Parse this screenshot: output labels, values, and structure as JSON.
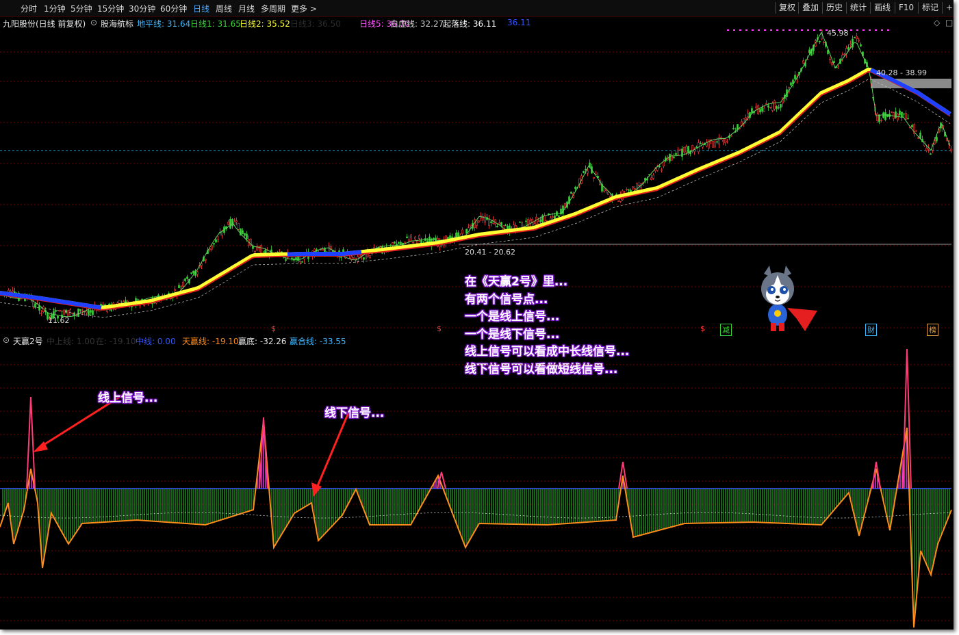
{
  "toolbar": {
    "periods": [
      "分时",
      "1分钟",
      "5分钟",
      "15分钟",
      "30分钟",
      "60分钟",
      "日线",
      "周线",
      "月线",
      "多周期",
      "更多 >"
    ],
    "active_period": "日线",
    "right_buttons": [
      "复权",
      "叠加",
      "历史",
      "统计",
      "画线",
      "F10",
      "标记",
      "+自"
    ]
  },
  "main_legend": {
    "stock": "九阳股份(日线 前复权)",
    "indicator": "股海航标",
    "items": [
      {
        "label": "地平线: 31.64",
        "color": "#3db8ff"
      },
      {
        "label": "日线1: 31.65",
        "color": "#37d437"
      },
      {
        "label": "日线2: 35.52",
        "color": "#ffff33"
      },
      {
        "label": "日线3: 36.50",
        "color": "#2c2c2c"
      },
      {
        "label": "日线5: 36.70",
        "color": "#ff55ff"
      },
      {
        "label": "白虚线: 32.27",
        "color": "#cccccc"
      },
      {
        "label": "起落线: 36.11",
        "color": "#ffffff"
      },
      {
        "label": "36.11",
        "color": "#3355ff"
      }
    ],
    "right_icons": [
      "◇",
      "□"
    ]
  },
  "price_labels": {
    "high": "45.98",
    "resistance": "40.28 - 38.99",
    "support": "20.41 - 20.62",
    "low": "11.62"
  },
  "event_marks": [
    {
      "text": "$",
      "color": "#ff3c3c"
    },
    {
      "text": "$",
      "color": "#ff3c3c"
    },
    {
      "text": "$",
      "color": "#ff3c3c"
    },
    {
      "text": "减",
      "color": "#37d437"
    },
    {
      "text": "财",
      "color": "#3db8ff"
    },
    {
      "text": "榜",
      "color": "#e0a040"
    }
  ],
  "sub_legend": {
    "name": "天赢2号",
    "items": [
      {
        "label": "中上线: 1.00",
        "color": "#333333"
      },
      {
        "label": "在: -19.10",
        "color": "#333333"
      },
      {
        "label": "中线: 0.00",
        "color": "#3355ff"
      },
      {
        "label": "天赢线: -19.10",
        "color": "#ff8c1a"
      },
      {
        "label": "赢底: -32.26",
        "color": "#e8e8e8"
      },
      {
        "label": "赢合线: -33.55",
        "color": "#3db8ff"
      }
    ]
  },
  "annotations": {
    "paragraph": [
      "在《天赢2号》里...",
      "有两个信号点...",
      "一个是线上信号...",
      "一个是线下信号...",
      "线上信号可以看成中长线信号...",
      "线下信号可以看做短线信号..."
    ],
    "up_signal": "线上信号...",
    "down_signal": "线下信号..."
  },
  "colors": {
    "up": "#ff3c3c",
    "down": "#37d437",
    "ma_yellow": "#ffff33",
    "ma_red": "#e02020",
    "ma_blue": "#2040ff",
    "grid": "#7a0000",
    "osc_bar_green": "#239a23",
    "osc_bar_magenta": "#ff40ff",
    "osc_line": "#ff8c1a",
    "annotation_glow": "#8a1bd8"
  },
  "mascot": "husky-superhero-icon"
}
